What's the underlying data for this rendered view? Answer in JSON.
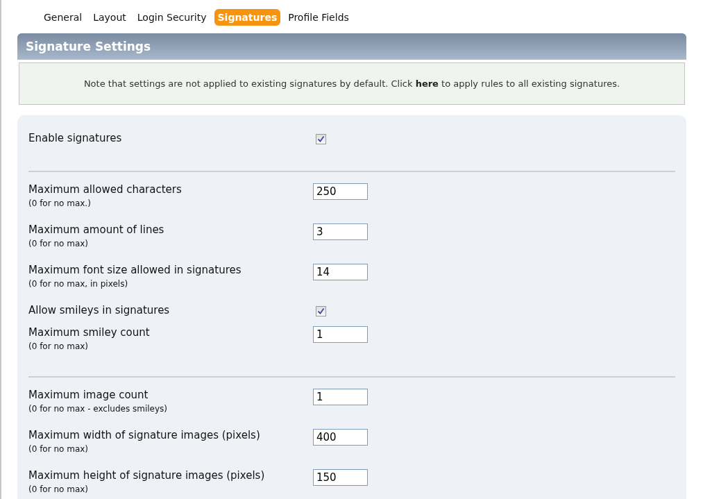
{
  "tabs": [
    {
      "label": "General",
      "selected": false
    },
    {
      "label": "Layout",
      "selected": false
    },
    {
      "label": "Login Security",
      "selected": false
    },
    {
      "label": "Signatures",
      "selected": true
    },
    {
      "label": "Profile Fields",
      "selected": false
    }
  ],
  "panel_title": "Signature Settings",
  "note": {
    "before": "Note that settings are not applied to existing signatures by default. Click ",
    "link": "here",
    "after": " to apply rules to all existing signatures."
  },
  "groups": [
    {
      "rows": [
        {
          "kind": "checkbox",
          "label": "Enable signatures",
          "checked": true
        }
      ]
    },
    {
      "rows": [
        {
          "kind": "text",
          "label": "Maximum allowed characters",
          "hint": "(0 for no max.)",
          "value": "250"
        },
        {
          "kind": "text",
          "label": "Maximum amount of lines",
          "hint": "(0 for no max)",
          "value": "3"
        },
        {
          "kind": "text",
          "label": "Maximum font size allowed in signatures",
          "hint": "(0 for no max, in pixels)",
          "value": "14"
        },
        {
          "kind": "checkbox",
          "label": "Allow smileys in signatures",
          "checked": true
        },
        {
          "kind": "text",
          "label": "Maximum smiley count",
          "hint": "(0 for no max)",
          "value": "1"
        }
      ]
    },
    {
      "rows": [
        {
          "kind": "text",
          "label": "Maximum image count",
          "hint": "(0 for no max - excludes smileys)",
          "value": "1"
        },
        {
          "kind": "text",
          "label": "Maximum width of signature images (pixels)",
          "hint": "(0 for no max)",
          "value": "400"
        },
        {
          "kind": "text",
          "label": "Maximum height of signature images (pixels)",
          "hint": "(0 for no max)",
          "value": "150"
        }
      ]
    }
  ]
}
